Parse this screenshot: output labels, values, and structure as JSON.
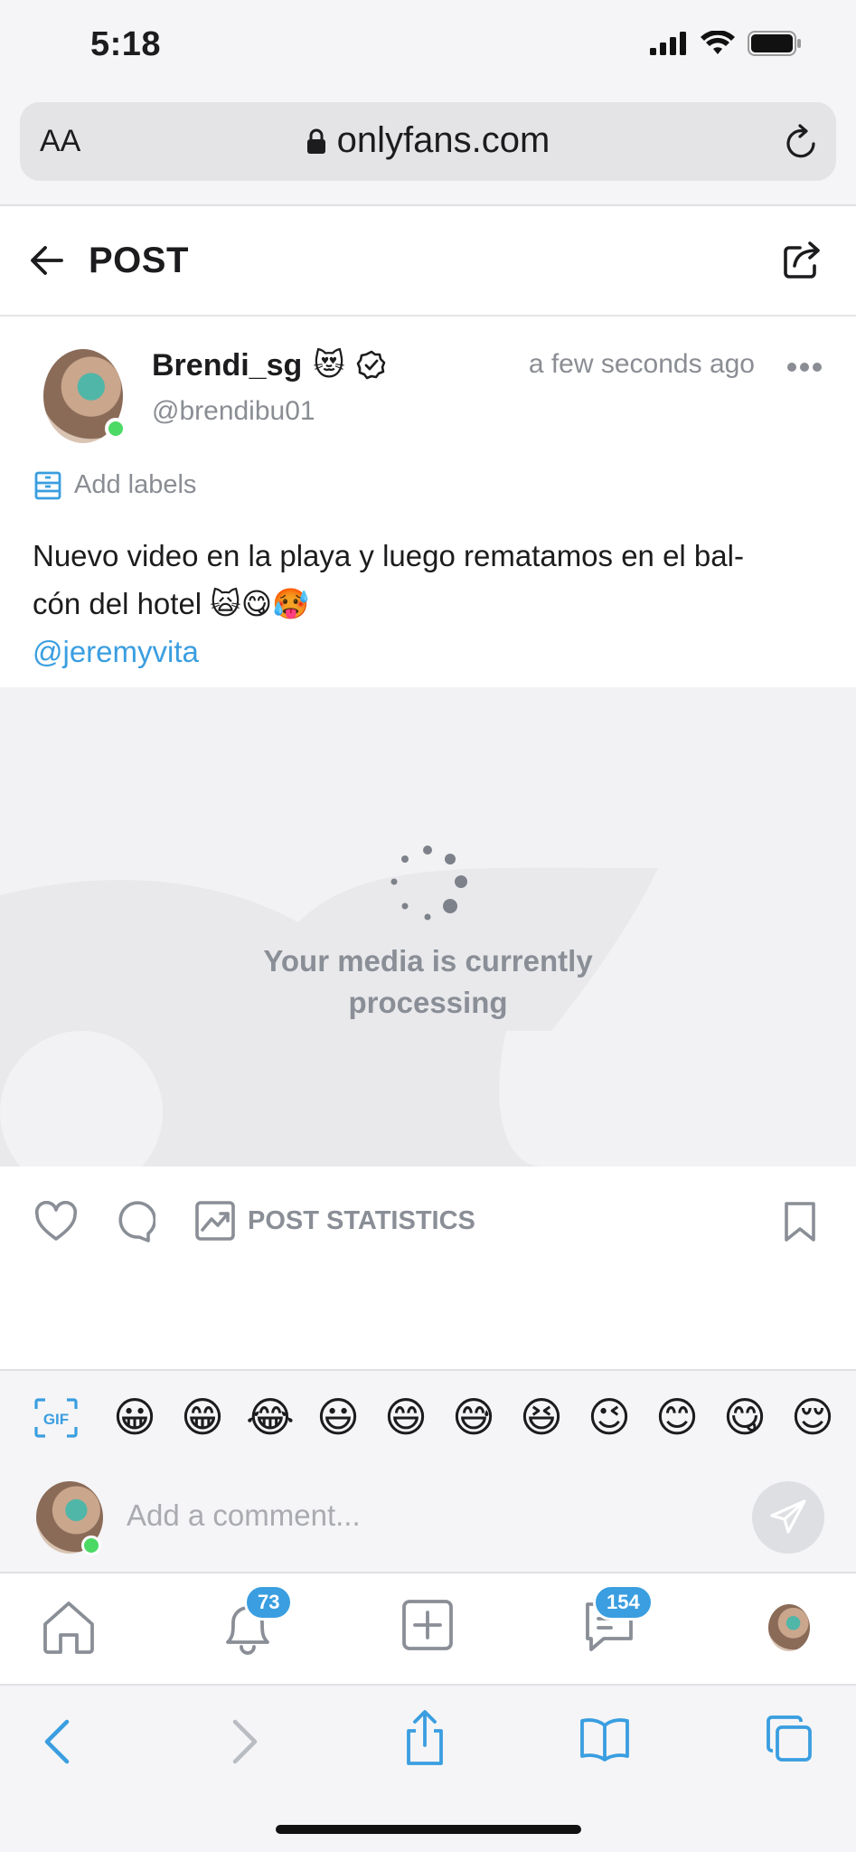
{
  "status_bar": {
    "time": "5:18"
  },
  "browser": {
    "aa_label": "AA",
    "url": "onlyfans.com"
  },
  "header": {
    "title": "POST"
  },
  "post": {
    "author_name": "Brendi_sg",
    "author_emoji": "😻",
    "handle": "@brendibu01",
    "timestamp": "a few seconds ago",
    "add_labels": "Add labels",
    "text_line1": "Nuevo video en la playa y luego rematamos en el bal-",
    "text_line2": "cón del hotel 🙀😋🥵",
    "mention": "@jeremyvita",
    "media_status_line1": "Your media is currently",
    "media_status_line2": "processing"
  },
  "actions": {
    "stats_label": "POST STATISTICS"
  },
  "comment": {
    "emojis": [
      "😀",
      "😁",
      "😂",
      "😃",
      "😄",
      "😅",
      "😆",
      "😉",
      "😊",
      "😋",
      "😌"
    ],
    "placeholder": "Add a comment..."
  },
  "app_nav": {
    "notifications_count": "73",
    "messages_count": "154"
  },
  "colors": {
    "accent": "#3a9ee0",
    "online": "#4cd964",
    "muted": "#8a8d93"
  }
}
